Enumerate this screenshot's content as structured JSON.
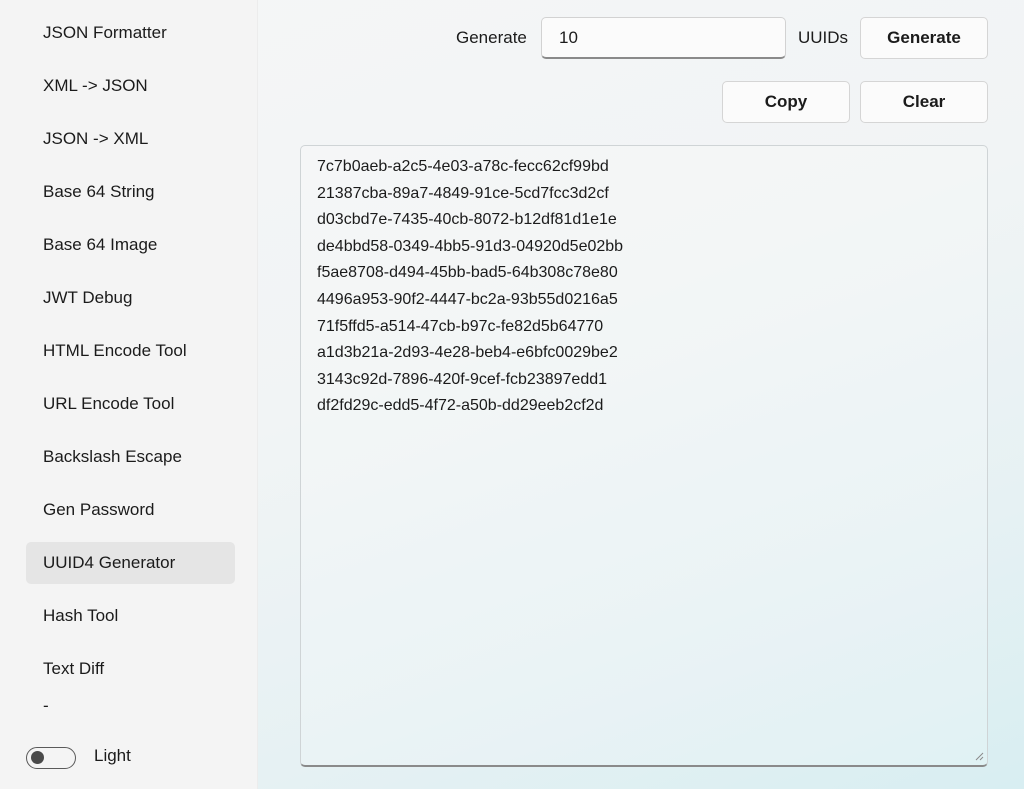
{
  "sidebar": {
    "items": [
      {
        "label": "JSON Formatter",
        "active": false
      },
      {
        "label": "XML -> JSON",
        "active": false
      },
      {
        "label": "JSON -> XML",
        "active": false
      },
      {
        "label": "Base 64 String",
        "active": false
      },
      {
        "label": "Base 64 Image",
        "active": false
      },
      {
        "label": "JWT Debug",
        "active": false
      },
      {
        "label": "HTML Encode Tool",
        "active": false
      },
      {
        "label": "URL Encode Tool",
        "active": false
      },
      {
        "label": "Backslash Escape",
        "active": false
      },
      {
        "label": "Gen Password",
        "active": false
      },
      {
        "label": "UUID4 Generator",
        "active": true
      },
      {
        "label": "Hash Tool",
        "active": false
      },
      {
        "label": "Text Diff",
        "active": false
      }
    ],
    "partial_item_label": "-"
  },
  "theme_toggle": {
    "label": "Light",
    "on": false
  },
  "generator": {
    "prefix_label": "Generate",
    "count_value": "10",
    "suffix_label": "UUIDs",
    "generate_button": "Generate",
    "copy_button": "Copy",
    "clear_button": "Clear"
  },
  "output": {
    "uuids": [
      "7c7b0aeb-a2c5-4e03-a78c-fecc62cf99bd",
      "21387cba-89a7-4849-91ce-5cd7fcc3d2cf",
      "d03cbd7e-7435-40cb-8072-b12df81d1e1e",
      "de4bbd58-0349-4bb5-91d3-04920d5e02bb",
      "f5ae8708-d494-45bb-bad5-64b308c78e80",
      "4496a953-90f2-4447-bc2a-93b55d0216a5",
      "71f5ffd5-a514-47cb-b97c-fe82d5b64770",
      "a1d3b21a-2d93-4e28-beb4-e6bfc0029be2",
      "3143c92d-7896-420f-9cef-fcb23897edd1",
      "df2fd29c-edd5-4f72-a50b-dd29eeb2cf2d"
    ]
  }
}
